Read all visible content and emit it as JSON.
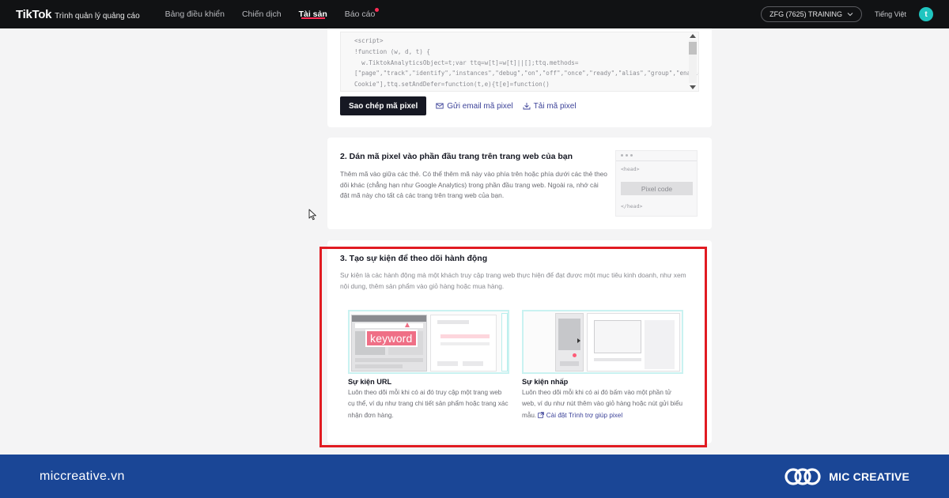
{
  "app": {
    "logo": "TikTok",
    "subtitle": "Trình quản lý quảng cáo"
  },
  "nav": {
    "items": [
      {
        "label": "Bảng điều khiển"
      },
      {
        "label": "Chiến dịch"
      },
      {
        "label": "Tài sản"
      },
      {
        "label": "Báo cáo"
      }
    ],
    "active": "Tài sản"
  },
  "account": {
    "selector": "ZFG (7625) TRAINING",
    "language": "Tiếng Việt",
    "avatar_letter": "t"
  },
  "step1": {
    "code_lines": [
      "<script>",
      "!function (w, d, t) {",
      "  w.TiktokAnalyticsObject=t;var ttq=w[t]=w[t]||[];ttq.methods=",
      "[\"page\",\"track\",\"identify\",\"instances\",\"debug\",\"on\",\"off\",\"once\",\"ready\",\"alias\",\"group\",\"enableCookie\",\"disable",
      "Cookie\"],ttq.setAndDefer=function(t,e){t[e]=function()"
    ],
    "copy_button": "Sao chép mã pixel",
    "email_link": "Gửi email mã pixel",
    "download_link": "Tải mã pixel"
  },
  "step2": {
    "heading": "2. Dán mã pixel vào phần đầu trang trên trang web của bạn",
    "description": "Thêm mã vào giữa các thẻ. Có thể thêm mã này vào phía trên hoặc phía dưới các thẻ theo dõi khác (chẳng hạn như Google Analytics) trong phần đầu trang web. Ngoài ra, nhớ cài đặt mã này cho tất cả các trang trên trang web của bạn.",
    "illus_head_open": "<head>",
    "illus_pixel": "Pixel code",
    "illus_head_close": "</head>"
  },
  "step3": {
    "heading": "3. Tạo sự kiện để theo dõi hành động",
    "description": "Sự kiện là các hành động mà một khách truy cập trang web thực hiện để đạt được một mục tiêu kinh doanh, như xem nội dung, thêm sản phẩm vào giỏ hàng hoặc mua hàng.",
    "url_event": {
      "keyword": "keyword",
      "title": "Sự kiện URL",
      "description": "Luôn theo dõi mỗi khi có ai đó truy cập một trang web cụ thể, ví dụ như trang chi tiết sản phẩm hoặc trang xác nhận đơn hàng."
    },
    "click_event": {
      "title": "Sự kiện nhấp",
      "description": "Luôn theo dõi mỗi khi có ai đó bấm vào một phần tử web, ví dụ như nút thêm vào giỏ hàng hoặc nút gửi biểu mẫu.",
      "link": "Cài đặt Trình trợ giúp pixel"
    }
  },
  "footer": {
    "site": "miccreative.vn",
    "brand": "MIC CREATIVE"
  },
  "colors": {
    "topbar": "#111214",
    "accent": "#fe2c55",
    "highlight": "#e11b22",
    "footer": "#1a4696",
    "link": "#3d4399"
  }
}
